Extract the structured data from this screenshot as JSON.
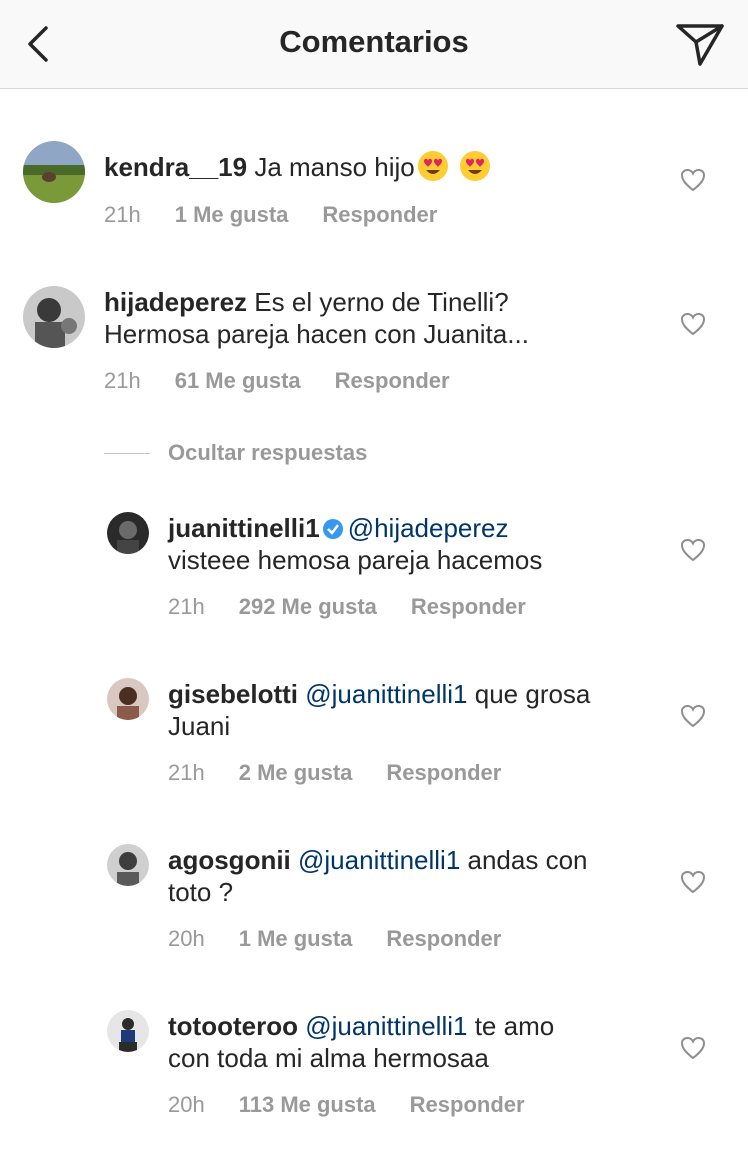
{
  "header": {
    "title": "Comentarios",
    "back_icon": "chevron-left-icon",
    "send_icon": "paper-plane-icon"
  },
  "hide_replies_label": "Ocultar respuestas",
  "reply_label": "Responder",
  "comments": [
    {
      "user": "kendra__19",
      "mention": "",
      "text": "Ja manso hijo",
      "emoji": "heart-eyes-emoji x2",
      "time": "21h",
      "likes": "1 Me gusta",
      "verified": false
    },
    {
      "user": "hijadeperez",
      "mention": "",
      "text": "Es el yerno de Tinelli?",
      "text2": "Hermosa pareja hacen con Juanita...",
      "time": "21h",
      "likes": "61 Me gusta",
      "verified": false
    },
    {
      "user": "juanittinelli1",
      "mention": "@hijadeperez",
      "text": "",
      "text2": "visteee hemosa pareja hacemos",
      "time": "21h",
      "likes": "292 Me gusta",
      "verified": true
    },
    {
      "user": "gisebelotti",
      "mention": "@juanittinelli1",
      "text": "que grosa",
      "text2": "Juani",
      "time": "21h",
      "likes": "2 Me gusta",
      "verified": false
    },
    {
      "user": "agosgonii",
      "mention": "@juanittinelli1",
      "text": "andas con",
      "text2": "toto ?",
      "time": "20h",
      "likes": "1 Me gusta",
      "verified": false
    },
    {
      "user": "totooteroo",
      "mention": "@juanittinelli1",
      "text": "te amo",
      "text2": "con toda mi alma hermosaa",
      "time": "20h",
      "likes": "113 Me gusta",
      "verified": false
    }
  ]
}
